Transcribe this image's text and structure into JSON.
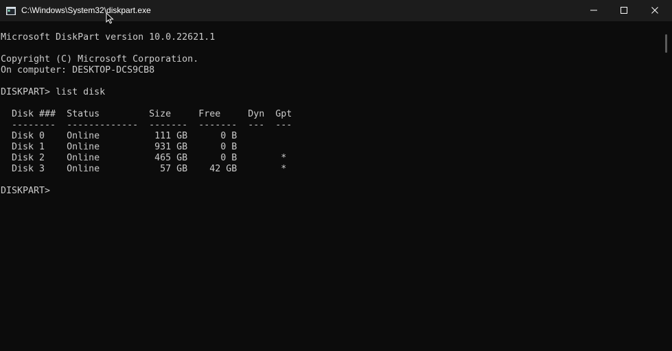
{
  "window": {
    "title": "C:\\Windows\\System32\\diskpart.exe"
  },
  "console": {
    "lines": [
      "Microsoft DiskPart version 10.0.22621.1",
      "",
      "Copyright (C) Microsoft Corporation.",
      "On computer: DESKTOP-DCS9CB8",
      "",
      "DISKPART> list disk",
      "",
      "  Disk ###  Status         Size     Free     Dyn  Gpt",
      "  --------  -------------  -------  -------  ---  ---",
      "  Disk 0    Online          111 GB      0 B",
      "  Disk 1    Online          931 GB      0 B",
      "  Disk 2    Online          465 GB      0 B        *",
      "  Disk 3    Online           57 GB    42 GB        *",
      "",
      "DISKPART> "
    ]
  },
  "icons": {
    "app": "console-app-icon",
    "cursor": "mouse-pointer-icon",
    "minimize": "minimize-icon",
    "maximize": "maximize-icon",
    "close": "close-icon"
  },
  "colors": {
    "titlebar": "#1c1c1c",
    "console_bg": "#0c0c0c",
    "console_text": "#cccccc"
  }
}
